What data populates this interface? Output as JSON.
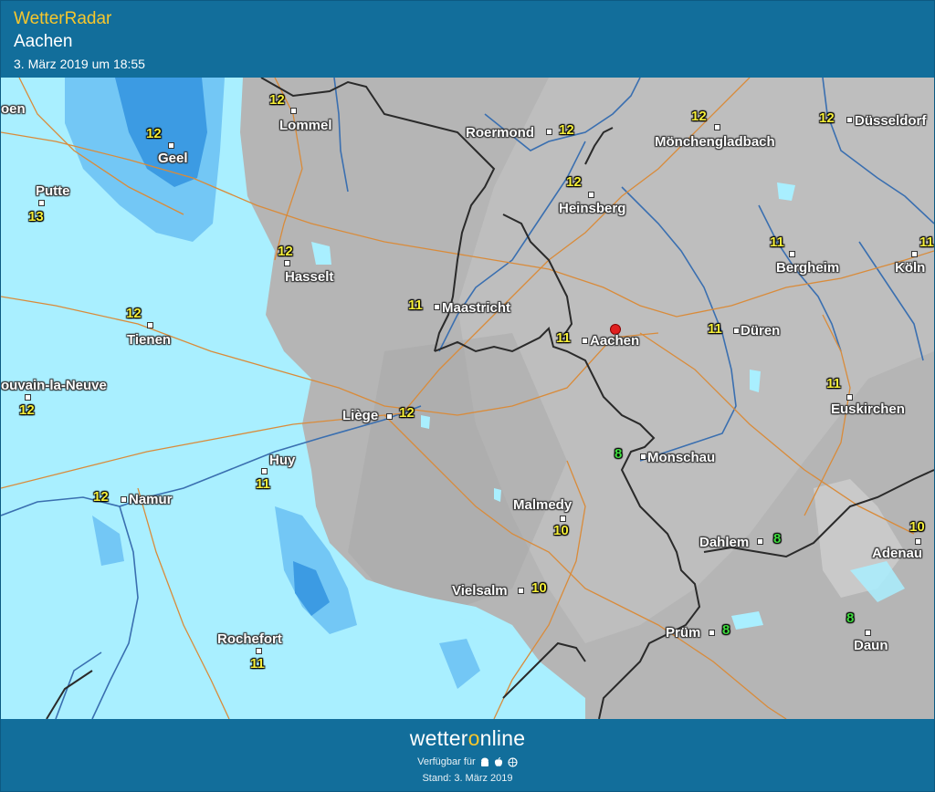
{
  "header": {
    "brand": "WetterRadar",
    "location": "Aachen",
    "timestamp": "3. März 2019 um 18:55"
  },
  "footer": {
    "logo_prefix": "wetter",
    "logo_o": "o",
    "logo_suffix": "nline",
    "available_label": "Verfügbar für",
    "platform_icons": [
      "android-icon",
      "apple-icon",
      "web-icon"
    ],
    "stand": "Stand: 3. März 2019"
  },
  "colors": {
    "header_bg": "#126e9b",
    "brand_text": "#f7c72c",
    "precip_light": "#a8f0ff",
    "precip_medium": "#73c6f5",
    "precip_heavy": "#3c9be3",
    "temp_yellow": "#f5ee3a",
    "temp_green": "#3fdc3f",
    "pin_red": "#e02020"
  },
  "map": {
    "marker": "location-pin-icon",
    "cities": [
      {
        "name": "Lommel"
      },
      {
        "name": "Geel"
      },
      {
        "name": "Roermond"
      },
      {
        "name": "Mönchengladbach"
      },
      {
        "name": "Düsseldorf"
      },
      {
        "name": "Putte"
      },
      {
        "name": "Heinsberg"
      },
      {
        "name": "Hasselt"
      },
      {
        "name": "Bergheim"
      },
      {
        "name": "Köln"
      },
      {
        "name": "Maastricht"
      },
      {
        "name": "Tienen"
      },
      {
        "name": "Aachen"
      },
      {
        "name": "Düren"
      },
      {
        "name": "ouvain-la-Neuve"
      },
      {
        "name": "Liège"
      },
      {
        "name": "Euskirchen"
      },
      {
        "name": "Huy"
      },
      {
        "name": "Monschau"
      },
      {
        "name": "Namur"
      },
      {
        "name": "Malmedy"
      },
      {
        "name": "Dahlem"
      },
      {
        "name": "Adenau"
      },
      {
        "name": "Vielsalm"
      },
      {
        "name": "Prüm"
      },
      {
        "name": "Rochefort"
      },
      {
        "name": "Daun"
      },
      {
        "name": "oen"
      }
    ],
    "temps": [
      {
        "value": "12",
        "color": "yellow"
      },
      {
        "value": "12",
        "color": "yellow"
      },
      {
        "value": "12",
        "color": "yellow"
      },
      {
        "value": "12",
        "color": "yellow"
      },
      {
        "value": "12",
        "color": "yellow"
      },
      {
        "value": "13",
        "color": "yellow"
      },
      {
        "value": "12",
        "color": "yellow"
      },
      {
        "value": "12",
        "color": "yellow"
      },
      {
        "value": "11",
        "color": "yellow"
      },
      {
        "value": "11",
        "color": "yellow"
      },
      {
        "value": "11",
        "color": "yellow"
      },
      {
        "value": "12",
        "color": "yellow"
      },
      {
        "value": "11",
        "color": "yellow"
      },
      {
        "value": "11",
        "color": "yellow"
      },
      {
        "value": "12",
        "color": "yellow"
      },
      {
        "value": "12",
        "color": "yellow"
      },
      {
        "value": "11",
        "color": "yellow"
      },
      {
        "value": "11",
        "color": "yellow"
      },
      {
        "value": "8",
        "color": "green"
      },
      {
        "value": "12",
        "color": "yellow"
      },
      {
        "value": "10",
        "color": "yellow"
      },
      {
        "value": "8",
        "color": "green"
      },
      {
        "value": "10",
        "color": "yellow"
      },
      {
        "value": "10",
        "color": "yellow"
      },
      {
        "value": "8",
        "color": "green"
      },
      {
        "value": "11",
        "color": "yellow"
      },
      {
        "value": "8",
        "color": "green"
      }
    ]
  }
}
